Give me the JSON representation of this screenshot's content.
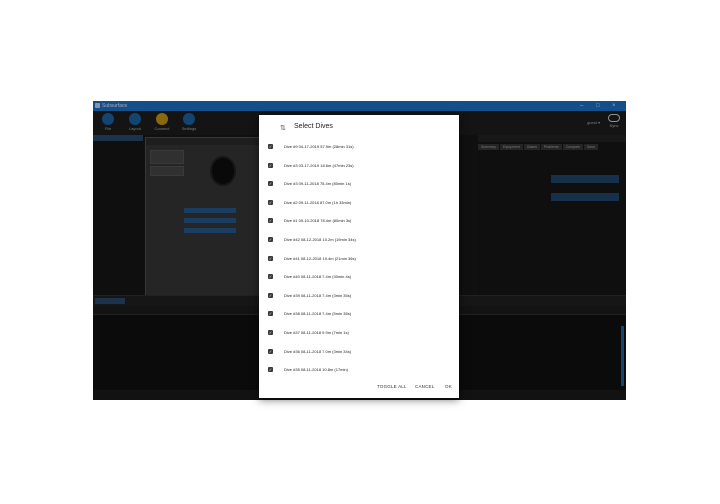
{
  "window": {
    "title": "Subsurface"
  },
  "toolbar": {
    "items": [
      {
        "label": "File",
        "icon": "download-icon"
      },
      {
        "label": "Layout",
        "icon": "layout-icon"
      },
      {
        "label": "Connect",
        "icon": "connect-icon"
      },
      {
        "label": "Settings",
        "icon": "gear-icon"
      }
    ],
    "user": "guest",
    "cloud_label": "Sync"
  },
  "right_tabs": [
    "Summary",
    "Equipment",
    "Gases",
    "Problems",
    "Compare",
    "Save"
  ],
  "dialog": {
    "title": "Select Dives",
    "dives": [
      "Dive #9 04-17-2019 57.9m (28min 31s)",
      "Dive #3 03-17-2019 18.6m (47min 23s)",
      "Dive #3 09-11-2018 75.4m (80min 1s)",
      "Dive #2 09-11-2018 87.0m (1h 33min)",
      "Dive #1 09-10-2018 78.4m (80min 3s)",
      "Dive #42 08-12-2018 10.2m (19min 34s)",
      "Dive #41 08-12-2018 19.4m (21min 36s)",
      "Dive #40 08-11-2018 7.4m (30min 4s)",
      "Dive #39 08-11-2018 7.4m (3min 35s)",
      "Dive #38 08-11-2018 7.4m (5min 35s)",
      "Dive #37 08-11-2018 9.9m (7min 1s)",
      "Dive #36 08-11-2018 7.0m (3min 34s)",
      "Dive #35 08-11-2018 10.8m (17min)"
    ],
    "actions": {
      "toggle": "TOGGLE ALL",
      "cancel": "CANCEL",
      "ok": "OK"
    }
  },
  "colors": {
    "titlebar": "#1f7ad6",
    "accent": "#d4a017",
    "app_bg": "#1a1a1a"
  }
}
